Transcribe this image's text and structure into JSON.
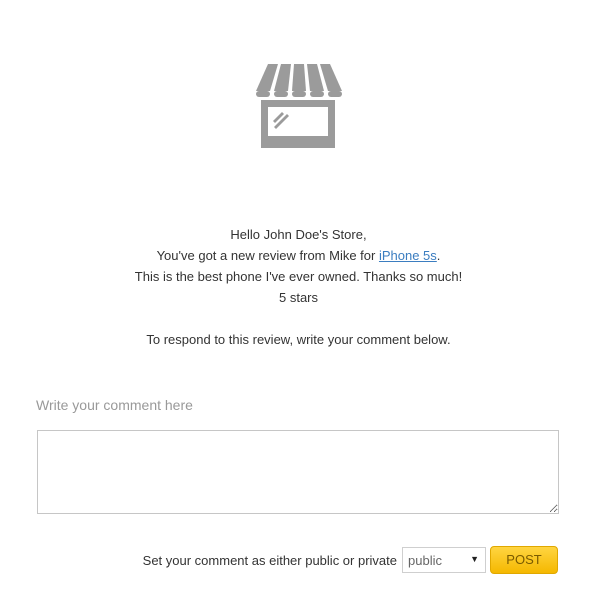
{
  "logo": {
    "icon": "storefront-icon",
    "color": "#9b9b9b"
  },
  "message": {
    "greeting": "Hello John Doe's Store,",
    "review_prefix": "You've got a new review from Mike for ",
    "product_link": "iPhone 5s",
    "review_suffix": ".",
    "review_text": "This is the best phone I've ever owned. Thanks so much!",
    "rating": "5 stars",
    "respond_instruction": "To respond to this review, write your comment below."
  },
  "comment": {
    "label": "Write your comment here",
    "value": ""
  },
  "visibility": {
    "label": "Set your comment as either public or private",
    "selected": "public",
    "arrow_icon": "dropdown-arrow-icon"
  },
  "post_button": {
    "label": "POST",
    "color": "#f5b800"
  }
}
